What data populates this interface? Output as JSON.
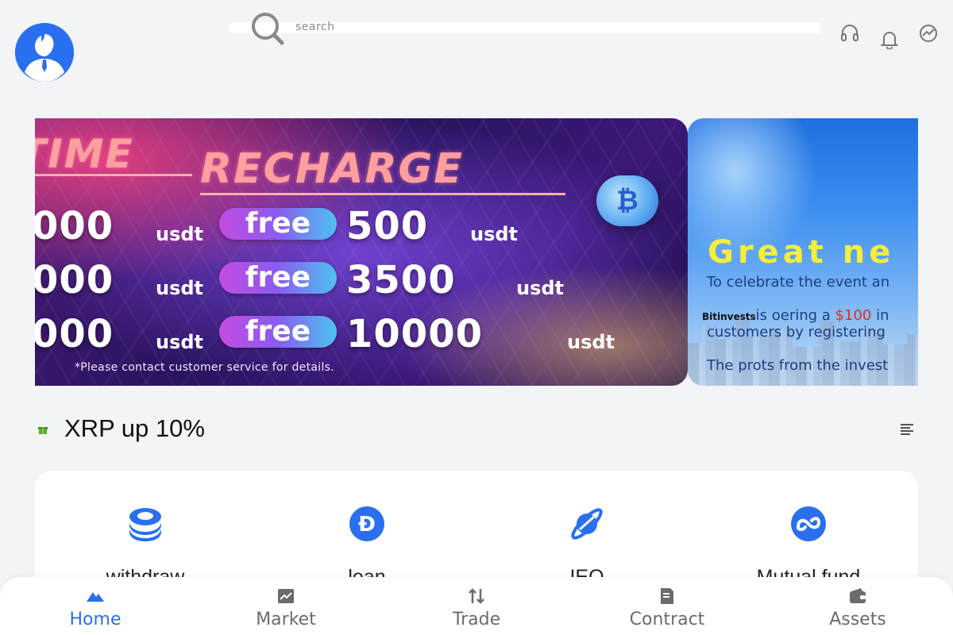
{
  "header": {
    "search_placeholder": "search",
    "avatar_icon": "user-avatar-icon",
    "right_icons": [
      "headset-icon",
      "bell-icon",
      "globe-icon"
    ]
  },
  "banner": {
    "slide1": {
      "title_left": "TIME",
      "title_main": "RECHARGE",
      "rows": [
        {
          "deposit": "000",
          "deposit_unit": "usdt",
          "free_label": "free",
          "bonus": "500",
          "bonus_unit": "usdt"
        },
        {
          "deposit": "000",
          "deposit_unit": "usdt",
          "free_label": "free",
          "bonus": "3500",
          "bonus_unit": "usdt"
        },
        {
          "deposit": "000",
          "deposit_unit": "usdt",
          "free_label": "free",
          "bonus": "10000",
          "bonus_unit": "usdt"
        }
      ],
      "note": "*Please contact customer service for details."
    },
    "slide2": {
      "headline": "Great ne",
      "line1": "To celebrate the event an",
      "brand": "Bitinvests",
      "line2_pre": "is oering a ",
      "line2_amount": "$100",
      "line2_post": " in",
      "line3": "customers by registering",
      "line4": "The prots from the invest"
    }
  },
  "notice": {
    "text": "XRP up 10%",
    "icon": "gift-icon",
    "menu_icon": "list-icon"
  },
  "quick_menu": [
    {
      "label": "withdraw",
      "icon": "stack-coin-icon"
    },
    {
      "label": "loan",
      "icon": "dogecoin-icon"
    },
    {
      "label": "IEO",
      "icon": "planet-icon"
    },
    {
      "label": "Mutual fund",
      "icon": "infinity-coin-icon"
    }
  ],
  "bottom_nav": [
    {
      "label": "Home",
      "icon": "home-icon",
      "active": true
    },
    {
      "label": "Market",
      "icon": "chart-icon",
      "active": false
    },
    {
      "label": "Trade",
      "icon": "arrows-updown-icon",
      "active": false
    },
    {
      "label": "Contract",
      "icon": "document-icon",
      "active": false
    },
    {
      "label": "Assets",
      "icon": "wallet-icon",
      "active": false
    }
  ],
  "colors": {
    "accent": "#2a6ff0",
    "background": "#f2f4f6",
    "nav_inactive": "#6b6b6b",
    "banner_gold": "#f5ef3a"
  }
}
